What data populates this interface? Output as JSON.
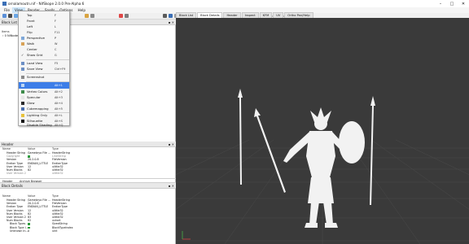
{
  "window": {
    "title": "ornalamoutn.nif - NifSkope 2.0.0 Pre-Alpha 6"
  },
  "menubar": [
    "File",
    "View",
    "Render",
    "Spells",
    "Options",
    "Help"
  ],
  "toolbar": {
    "slider_label": "LOD"
  },
  "view_tabs": [
    "Block List",
    "Block Details",
    "Header",
    "Inspect",
    "KFM",
    "UV",
    "Ortho Pan/Help"
  ],
  "block_list": {
    "title": "Block List",
    "col_items": "Items",
    "root_node": "0 NiNode"
  },
  "render_menu": {
    "items": [
      {
        "label": "Top",
        "key": "F"
      },
      {
        "label": "Front",
        "key": "F"
      },
      {
        "label": "Left",
        "key": "L"
      },
      {
        "label": "Flip",
        "key": "F11"
      },
      {
        "label": "Perspective",
        "key": "P"
      },
      {
        "label": "Walk",
        "key": "W"
      },
      {
        "label": "Center",
        "key": "C"
      },
      {
        "label": "Show Grid",
        "key": "G"
      },
      {
        "label": "Load View",
        "key": "F5"
      },
      {
        "label": "Save View",
        "key": "Ctrl+F9"
      },
      {
        "label": "Screenshot",
        "key": ""
      },
      {
        "label": "",
        "key": "Alt+1"
      },
      {
        "label": "Vertex Colors",
        "key": "Alt+2"
      },
      {
        "label": "Specular",
        "key": "Alt+3"
      },
      {
        "label": "Glow",
        "key": "Alt+4"
      },
      {
        "label": "Cubemapping",
        "key": "Alt+5"
      },
      {
        "label": "Lighting Only",
        "key": "Alt+L"
      },
      {
        "label": "Silhouette",
        "key": "Alt+S"
      },
      {
        "label": "Disable Shading",
        "key": "Alt+Q"
      }
    ]
  },
  "header_panel": {
    "title": "Header",
    "columns": [
      "Name",
      "Value",
      "Type"
    ],
    "rows": [
      {
        "name": "Header String",
        "value": "Gamebryo File ...",
        "type": "HeaderString"
      },
      {
        "name": "Copyright",
        "value": "",
        "type": "LineString"
      },
      {
        "name": "Version",
        "value": "20.2.0.8",
        "type": "FileVersion"
      },
      {
        "name": "Endian Type",
        "value": "ENDIAN_LITTLE",
        "type": "EndianType"
      },
      {
        "name": "User Version",
        "value": "12",
        "type": "ulittle32"
      },
      {
        "name": "Num Blocks",
        "value": "82",
        "type": "ulittle32"
      },
      {
        "name": "User Version 2",
        "value": "",
        "type": "ulittle32"
      }
    ],
    "address_label": "Archive Browser"
  },
  "block_details": {
    "title": "Block Details",
    "columns": [
      "Name",
      "Value",
      "Type"
    ],
    "rows": [
      {
        "name": "Header String",
        "value": "Gamebryo File ...",
        "type": "HeaderString"
      },
      {
        "name": "Version",
        "value": "20.2.0.8",
        "type": "FileVersion"
      },
      {
        "name": "Endian Type",
        "value": "ENDIAN_LITTLE",
        "type": "EndianType"
      },
      {
        "name": "User Version",
        "value": "12",
        "type": "ulittle32"
      },
      {
        "name": "Num Blocks",
        "value": "82",
        "type": "ulittle32"
      },
      {
        "name": "User Version 2",
        "value": "83",
        "type": "ulittle32"
      },
      {
        "name": "Num Blocks",
        "value": "82",
        "type": "ushort"
      },
      {
        "name": "Block Types",
        "value": "",
        "type": "SizedString"
      },
      {
        "name": "Block Type I...",
        "value": "",
        "type": "BlockTypeIndex"
      },
      {
        "name": "Unknown In...",
        "value": "0",
        "type": "uint"
      }
    ]
  },
  "colors": {
    "viewport_bg": "#3a3a3a",
    "grid": "#4a4a4a",
    "menu_highlight": "#3d7ee8",
    "model": "#f2f2f2"
  }
}
